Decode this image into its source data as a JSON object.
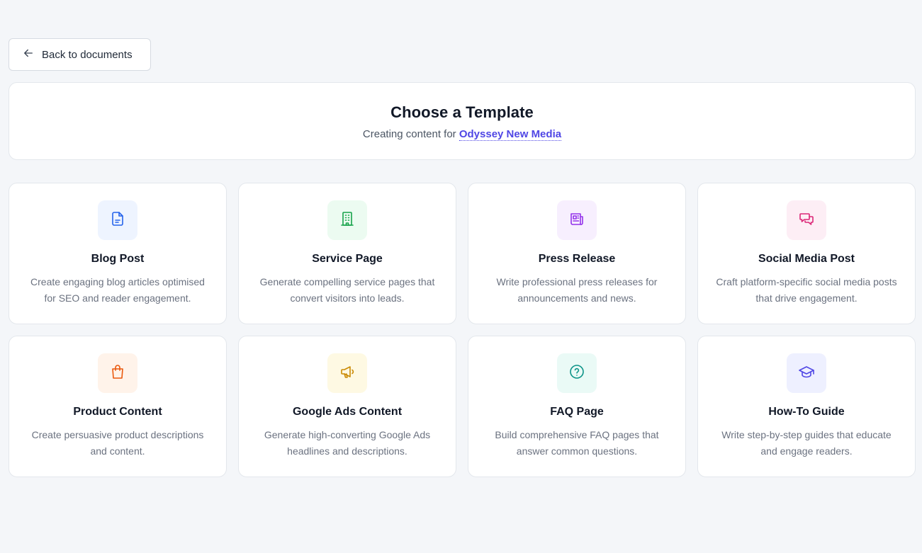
{
  "back_button": {
    "label": "Back to documents",
    "icon": "arrow-left-icon"
  },
  "header": {
    "title": "Choose a Template",
    "subtitle_prefix": "Creating content for",
    "client_name": "Odyssey New Media"
  },
  "templates": [
    {
      "title": "Blog Post",
      "description": "Create engaging blog articles optimised for SEO and reader engagement.",
      "icon": "document-icon",
      "color": "#2563eb",
      "bg": "#eef4ff"
    },
    {
      "title": "Service Page",
      "description": "Generate compelling service pages that convert visitors into leads.",
      "icon": "building-icon",
      "color": "#16a34a",
      "bg": "#ecfbf1"
    },
    {
      "title": "Press Release",
      "description": "Write professional press releases for announcements and news.",
      "icon": "newspaper-icon",
      "color": "#9333ea",
      "bg": "#f7effe"
    },
    {
      "title": "Social Media Post",
      "description": "Craft platform-specific social media posts that drive engagement.",
      "icon": "chat-bubbles-icon",
      "color": "#db2777",
      "bg": "#fdeef5"
    },
    {
      "title": "Product Content",
      "description": "Create persuasive product descriptions and content.",
      "icon": "shopping-bag-icon",
      "color": "#ea580c",
      "bg": "#fff3ea"
    },
    {
      "title": "Google Ads Content",
      "description": "Generate high-converting Google Ads headlines and descriptions.",
      "icon": "megaphone-icon",
      "color": "#ca8a04",
      "bg": "#fef9e3"
    },
    {
      "title": "FAQ Page",
      "description": "Build comprehensive FAQ pages that answer common questions.",
      "icon": "question-circle-icon",
      "color": "#0d9488",
      "bg": "#eafaf6"
    },
    {
      "title": "How-To Guide",
      "description": "Write step-by-step guides that educate and engage readers.",
      "icon": "graduation-cap-icon",
      "color": "#4f46e5",
      "bg": "#eef0ff"
    }
  ]
}
